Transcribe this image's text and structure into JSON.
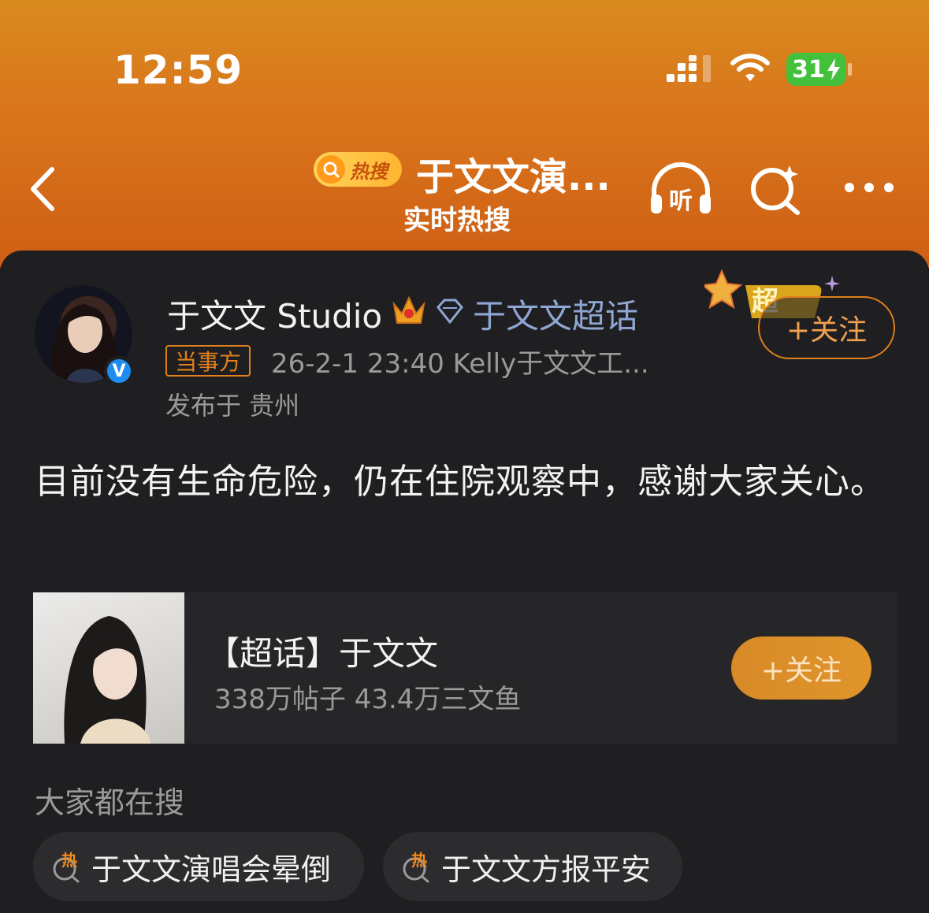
{
  "status_bar": {
    "time": "12:59",
    "battery": "31"
  },
  "header": {
    "hot_tag_label": "热搜",
    "title": "于文文演...",
    "subtitle": "实时热搜",
    "listen_label": "听"
  },
  "post": {
    "author": "于文文 Studio",
    "super_topic_link": "于文文超话",
    "party_tag": "当事方",
    "timestamp": "26-2-1 23:40",
    "source": "Kelly于文文工...",
    "location": "发布于 贵州",
    "follow_label": "+关注",
    "deco_label": "超",
    "content": "目前没有生命危险，仍在住院观察中，感谢大家关心。"
  },
  "topic_card": {
    "name": "【超话】于文文",
    "stats": "338万帖子 43.4万三文鱼",
    "follow_label": "+关注"
  },
  "trending": {
    "title": "大家都在搜",
    "hot_badge": "热",
    "items": [
      {
        "label": "于文文演唱会晕倒"
      },
      {
        "label": "于文文方报平安"
      }
    ]
  },
  "colors": {
    "accent": "#e0801e",
    "link": "#8fa6d4",
    "verified": "#1f8cf0",
    "battery": "#43c03c"
  }
}
